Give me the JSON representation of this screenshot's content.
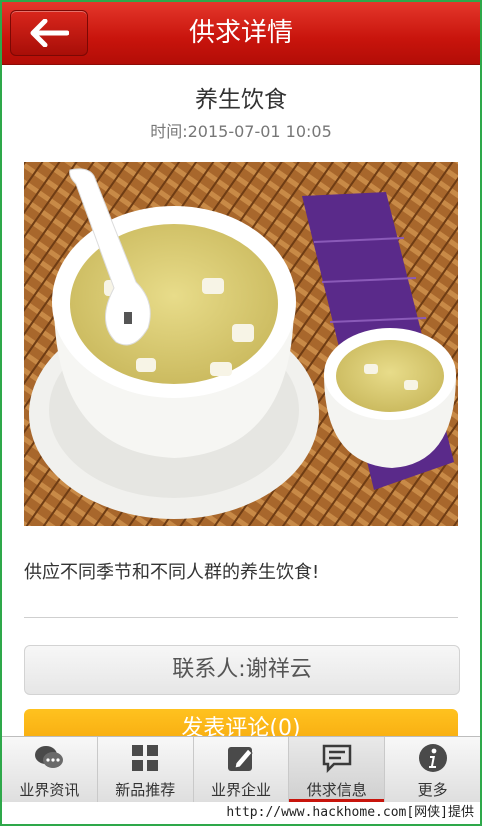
{
  "header": {
    "title": "供求详情",
    "back_icon": "back-arrow-icon"
  },
  "post": {
    "title": "养生饮食",
    "time": "时间:2015-07-01 10:05",
    "image_subject": "bowls of millet porridge on a bamboo mat",
    "body": "供应不同季节和不同人群的养生饮食!"
  },
  "actions": {
    "contact_label": "联系人:谢祥云",
    "comment_label": "发表评论(0)"
  },
  "tabbar": {
    "items": [
      {
        "label": "业界资讯",
        "icon": "chat-bubbles-icon"
      },
      {
        "label": "新品推荐",
        "icon": "grid-icon"
      },
      {
        "label": "业界企业",
        "icon": "edit-icon"
      },
      {
        "label": "供求信息",
        "icon": "message-icon"
      },
      {
        "label": "更多",
        "icon": "info-icon"
      }
    ],
    "active_index": 3
  },
  "watermark": "http://www.hackhome.com[网侠]提供",
  "colors": {
    "header_red": "#c8140c",
    "comment_orange": "#f4a30a"
  }
}
